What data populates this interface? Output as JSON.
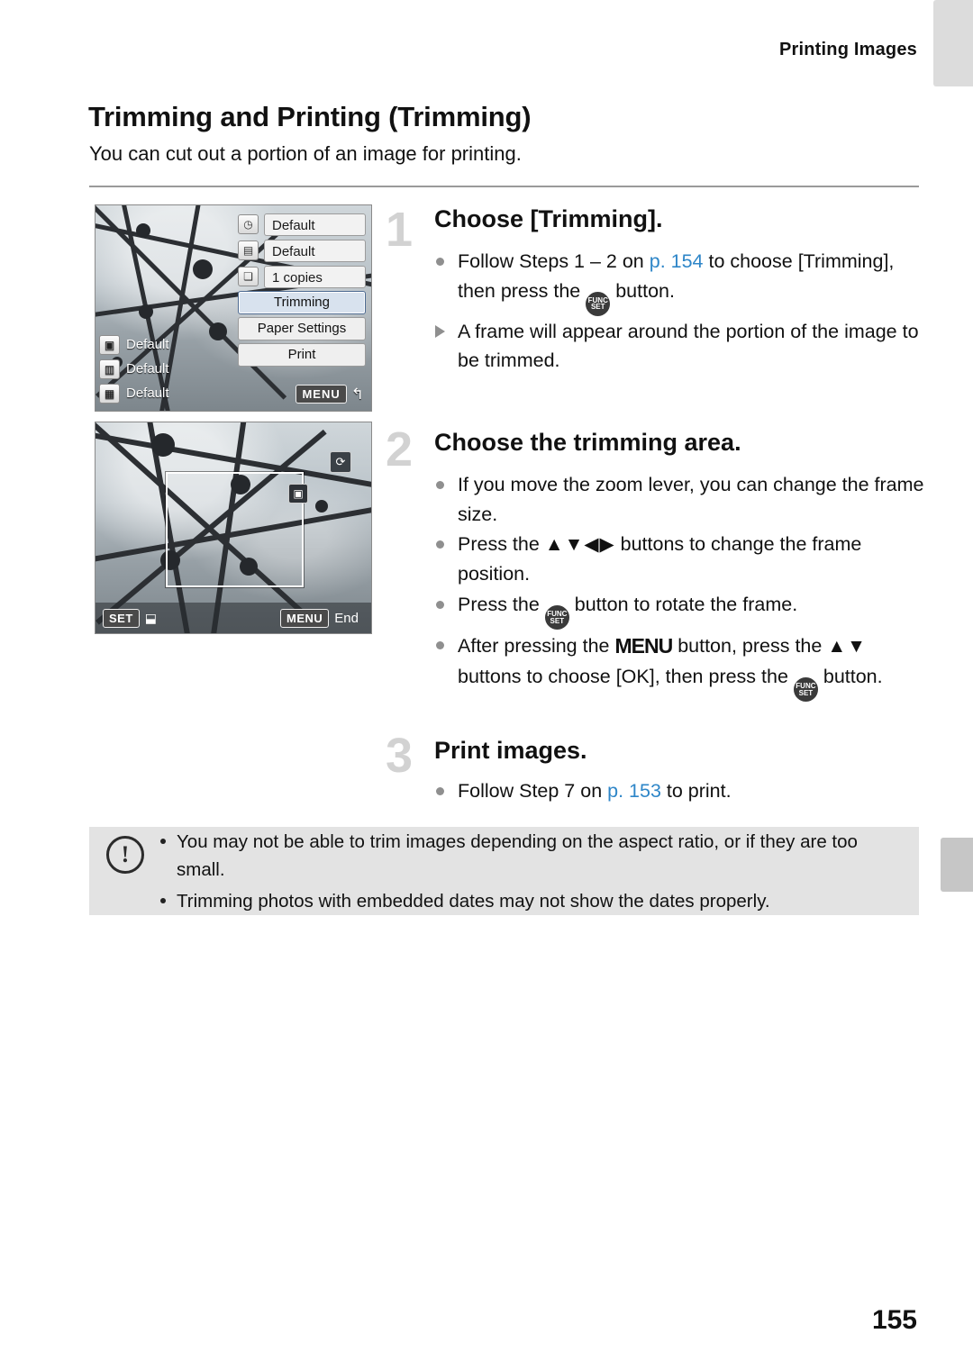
{
  "header": {
    "section_title": "Printing Images"
  },
  "page": {
    "title": "Trimming and Printing (Trimming)",
    "lede": "You can cut out a portion of an image for printing.",
    "number": "155"
  },
  "figure1": {
    "rows": [
      {
        "icon": "clock-icon",
        "value": "Default"
      },
      {
        "icon": "image-icon",
        "value": "Default"
      },
      {
        "icon": "copies-icon",
        "value": "1 copies"
      }
    ],
    "buttons": [
      {
        "label": "Trimming",
        "selected": true
      },
      {
        "label": "Paper Settings",
        "selected": false
      },
      {
        "label": "Print",
        "selected": false
      }
    ],
    "left_items": [
      {
        "icon": "paper-size-icon",
        "label": "Default"
      },
      {
        "icon": "paper-type-icon",
        "label": "Default"
      },
      {
        "icon": "layout-icon",
        "label": "Default"
      }
    ],
    "menu_badge": "MENU",
    "menu_arrow": "↰"
  },
  "figure2": {
    "set_badge": "SET",
    "set_icon": "trim-frame-icon",
    "menu_badge": "MENU",
    "menu_label": "End",
    "rotate_icon": "rotate-icon",
    "corner_icon": "resize-icon"
  },
  "steps": [
    {
      "number": "1",
      "title": "Choose [Trimming].",
      "bullets": [
        {
          "marker": "dot",
          "parts": [
            {
              "t": "Follow Steps 1 – 2 on "
            },
            {
              "t": "p. 154",
              "link": true
            },
            {
              "t": " to choose [Trimming], then press the "
            },
            {
              "t": "FUNC-SET-button",
              "glyph": "func"
            },
            {
              "t": " button."
            }
          ]
        },
        {
          "marker": "triangle",
          "parts": [
            {
              "t": "A frame will appear around the portion of the image to be trimmed."
            }
          ]
        }
      ]
    },
    {
      "number": "2",
      "title": "Choose the trimming area.",
      "bullets": [
        {
          "marker": "dot",
          "parts": [
            {
              "t": "If you move the zoom lever, you can change the frame size."
            }
          ]
        },
        {
          "marker": "dot",
          "parts": [
            {
              "t": "Press the "
            },
            {
              "t": "up-down-left-right-arrows",
              "glyph": "arrows4"
            },
            {
              "t": " buttons to change the frame position."
            }
          ]
        },
        {
          "marker": "dot",
          "parts": [
            {
              "t": "Press the "
            },
            {
              "t": "FUNC-SET-button",
              "glyph": "func"
            },
            {
              "t": " button to rotate the frame."
            }
          ]
        },
        {
          "marker": "dot",
          "parts": [
            {
              "t": "After pressing the "
            },
            {
              "t": "MENU",
              "glyph": "menu"
            },
            {
              "t": " button, press the "
            },
            {
              "t": "up-down-arrows",
              "glyph": "arrows2"
            },
            {
              "t": " buttons to choose [OK], then press the "
            },
            {
              "t": "FUNC-SET-button",
              "glyph": "func"
            },
            {
              "t": " button."
            }
          ]
        }
      ]
    },
    {
      "number": "3",
      "title": "Print images.",
      "bullets": [
        {
          "marker": "dot",
          "parts": [
            {
              "t": "Follow Step 7 on "
            },
            {
              "t": "p. 153",
              "link": true
            },
            {
              "t": " to print."
            }
          ]
        }
      ]
    }
  ],
  "caution": {
    "icon": "exclamation-icon",
    "items": [
      "You may not be able to trim images depending on the aspect ratio, or if they are too small.",
      "Trimming photos with embedded dates may not show the dates properly."
    ]
  },
  "colors": {
    "link": "#2e86c8",
    "step_number": "#d2d2d2",
    "caution_bg": "#e3e3e3",
    "tab_bg": "#dcdcdc"
  }
}
